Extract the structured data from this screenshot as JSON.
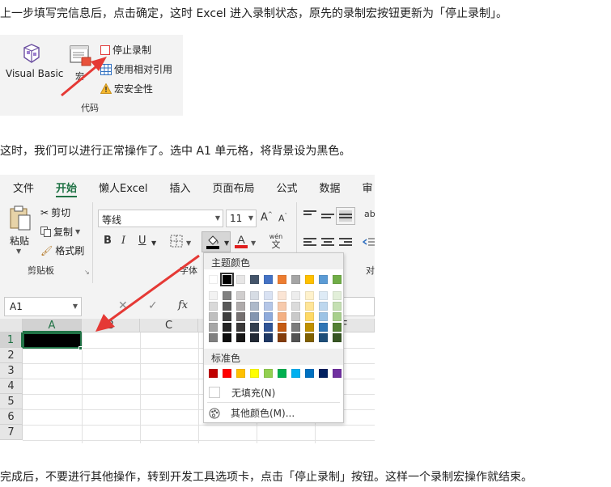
{
  "text": {
    "para1": "上一步填写完信息后，点击确定，这时 Excel 进入录制状态，原先的录制宏按钮更新为「停止录制」。",
    "para2": "这时，我们可以进行正常操作了。选中 A1 单元格，将背景设为黑色。",
    "para3": "完成后，不要进行其他操作，转到开发工具选项卡，点击「停止录制」按钮。这样一个录制宏操作就结束。"
  },
  "code_group": {
    "visual_basic_label": "Visual Basic",
    "macro_label": "宏",
    "stop_recording_label": "停止录制",
    "relative_ref_label": "使用相对引用",
    "macro_security_label": "宏安全性",
    "group_label": "代码"
  },
  "excel": {
    "tabs": [
      "文件",
      "开始",
      "懒人Excel",
      "插入",
      "页面布局",
      "公式",
      "数据",
      "审"
    ],
    "active_tab": "开始",
    "clipboard": {
      "paste_label": "粘贴",
      "cut_label": "剪切",
      "copy_label": "复制",
      "format_painter_label": "格式刷",
      "group_label": "剪贴板"
    },
    "font": {
      "font_name": "等线",
      "font_size": "11",
      "bold": "B",
      "italic": "I",
      "underline": "U",
      "grow": "A",
      "shrink": "A",
      "phonetic_top": "wén",
      "phonetic_bottom": "文",
      "group_label": "字体"
    },
    "alignment_group_label": "对",
    "name_box": "A1",
    "fx_label": "fx",
    "columns": [
      "A",
      "B",
      "C"
    ],
    "rows": [
      "1",
      "2",
      "3",
      "4",
      "5",
      "6",
      "7"
    ],
    "partial_column": "F",
    "selected_cell": "A1",
    "fill_color": "#000000",
    "accent_color": "#217346",
    "palette": {
      "theme_title": "主题颜色",
      "standard_title": "标准色",
      "no_fill_label": "无填充(N)",
      "more_colors_label": "其他颜色(M)...",
      "theme_top": [
        "#FFFFFF",
        "#000000",
        "#E7E6E6",
        "#44546A",
        "#4472C4",
        "#ED7D31",
        "#A5A5A5",
        "#FFC000",
        "#5B9BD5",
        "#70AD47"
      ],
      "theme_shades": [
        [
          "#F2F2F2",
          "#808080",
          "#D0CECE",
          "#D6DCE4",
          "#D9E2F3",
          "#FBE5D5",
          "#EDEDED",
          "#FFF2CC",
          "#DEEBF6",
          "#E2EFD9"
        ],
        [
          "#D9D9D9",
          "#595959",
          "#AEAAAA",
          "#ADB9CA",
          "#B4C6E7",
          "#F7CAAC",
          "#DBDBDB",
          "#FFE598",
          "#BDD7EE",
          "#C5E0B3"
        ],
        [
          "#BFBFBF",
          "#404040",
          "#757070",
          "#8496B0",
          "#8EAADB",
          "#F4B083",
          "#C9C9C9",
          "#FFD965",
          "#9CC3E5",
          "#A8D08D"
        ],
        [
          "#A6A6A6",
          "#262626",
          "#3A3838",
          "#323F4F",
          "#2F5496",
          "#C55A11",
          "#7B7B7B",
          "#BF9000",
          "#2E75B5",
          "#538135"
        ],
        [
          "#808080",
          "#0D0D0D",
          "#171616",
          "#222A35",
          "#1F3864",
          "#833C0B",
          "#525252",
          "#7F6000",
          "#1E4E79",
          "#375623"
        ]
      ],
      "standard": [
        "#C00000",
        "#FF0000",
        "#FFC000",
        "#FFFF00",
        "#92D050",
        "#00B050",
        "#00B0F0",
        "#0070C0",
        "#002060",
        "#7030A0"
      ],
      "selected_color": "#000000"
    }
  },
  "annotation_color": "#E53935"
}
